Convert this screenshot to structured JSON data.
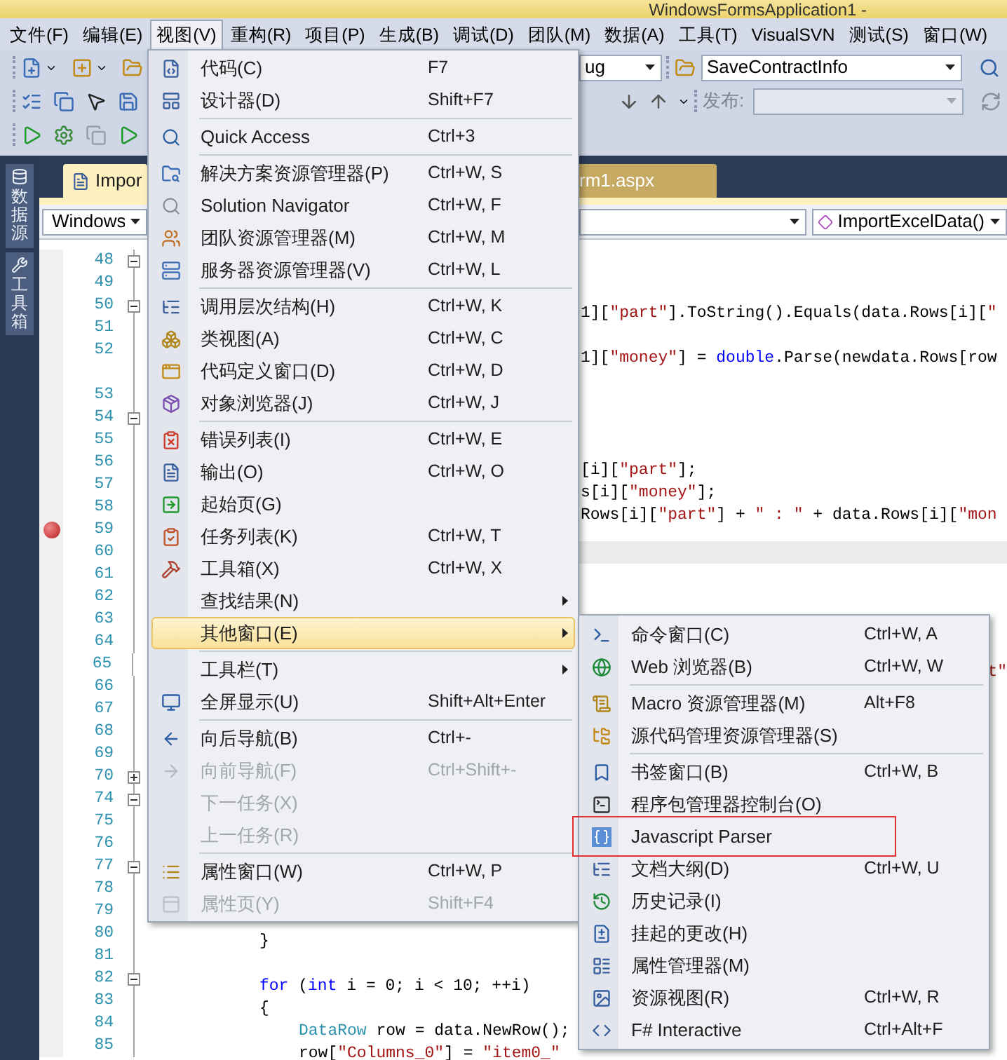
{
  "window": {
    "title": "WindowsFormsApplication1 -"
  },
  "menu_bar": [
    {
      "label": "文件(F)",
      "selected": false
    },
    {
      "label": "编辑(E)",
      "selected": false
    },
    {
      "label": "视图(V)",
      "selected": true
    },
    {
      "label": "重构(R)",
      "selected": false
    },
    {
      "label": "项目(P)",
      "selected": false
    },
    {
      "label": "生成(B)",
      "selected": false
    },
    {
      "label": "调试(D)",
      "selected": false
    },
    {
      "label": "团队(M)",
      "selected": false
    },
    {
      "label": "数据(A)",
      "selected": false
    },
    {
      "label": "工具(T)",
      "selected": false
    },
    {
      "label": "VisualSVN",
      "selected": false
    },
    {
      "label": "测试(S)",
      "selected": false
    },
    {
      "label": "窗口(W)",
      "selected": false
    }
  ],
  "toolbar": {
    "configuration_combo": "ug",
    "function_combo": "SaveContractInfo",
    "publish_label": "发布:",
    "publish_combo": {
      "disabled": true
    }
  },
  "side_tabs": [
    "数据源",
    "工具箱"
  ],
  "document_tabs": [
    {
      "label": "Impor",
      "selected": true
    },
    {
      "label": "rm1.aspx",
      "selected": false
    }
  ],
  "navigation": {
    "type_combo": "Windows",
    "member_combo": "ImportExcelData()"
  },
  "code_lines": [
    {
      "number": "48",
      "expanded": true,
      "breakpoint": false,
      "current": false
    },
    {
      "number": "49",
      "breakpoint": false,
      "current": false
    },
    {
      "number": "50",
      "expanded": true,
      "breakpoint": false,
      "current": false,
      "kind": "beside-menu",
      "segments": [
        {
          "text": "1][",
          "color": "#000000"
        },
        {
          "text": "\"part\"",
          "color": "#a31515"
        },
        {
          "text": "].ToString().Equals(data.Rows[i][",
          "color": "#000000"
        },
        {
          "text": "\"",
          "color": "#a31515"
        }
      ]
    },
    {
      "number": "51",
      "breakpoint": false,
      "current": false
    },
    {
      "number": "52",
      "breakpoint": false,
      "current": false,
      "kind": "beside-menu",
      "segments": [
        {
          "text": "1][",
          "color": "#000000"
        },
        {
          "text": "\"money\"",
          "color": "#a31515"
        },
        {
          "text": "] = ",
          "color": "#000000"
        },
        {
          "text": "double",
          "color": "#0000ff"
        },
        {
          "text": ".Parse(newdata.Rows[row",
          "color": "#000000"
        }
      ]
    },
    {
      "breakpoint": false,
      "current": false
    },
    {
      "number": "53",
      "breakpoint": false,
      "current": false
    },
    {
      "number": "54",
      "expanded": true,
      "breakpoint": false,
      "current": false
    },
    {
      "number": "55",
      "breakpoint": false,
      "current": false
    },
    {
      "number": "56",
      "breakpoint": false,
      "current": false,
      "kind": "beside-menu",
      "segments": [
        {
          "text": "[i][",
          "color": "#000000"
        },
        {
          "text": "\"part\"",
          "color": "#a31515"
        },
        {
          "text": "];",
          "color": "#000000"
        }
      ]
    },
    {
      "number": "57",
      "breakpoint": false,
      "current": false,
      "kind": "beside-menu",
      "segments": [
        {
          "text": "s[i][",
          "color": "#000000"
        },
        {
          "text": "\"money\"",
          "color": "#a31515"
        },
        {
          "text": "];",
          "color": "#000000"
        }
      ]
    },
    {
      "number": "58",
      "breakpoint": false,
      "current": false,
      "kind": "beside-menu",
      "segments": [
        {
          "text": "Rows[i][",
          "color": "#000000"
        },
        {
          "text": "\"part\"",
          "color": "#a31515"
        },
        {
          "text": "] + ",
          "color": "#000000"
        },
        {
          "text": "\" : \"",
          "color": "#a31515"
        },
        {
          "text": " + data.Rows[i][",
          "color": "#000000"
        },
        {
          "text": "\"mon",
          "color": "#a31515"
        }
      ]
    },
    {
      "number": "59",
      "breakpoint": true,
      "current": false
    },
    {
      "number": "60",
      "breakpoint": false,
      "current": true
    },
    {
      "number": "61",
      "breakpoint": false,
      "current": false
    },
    {
      "number": "62",
      "breakpoint": false,
      "current": false
    },
    {
      "number": "63",
      "breakpoint": false,
      "current": false
    },
    {
      "number": "64",
      "breakpoint": false,
      "current": false
    },
    {
      "number": "65",
      "breakpoint": false,
      "current": false,
      "kind": "far-right",
      "segments": [
        {
          "text": "t\"",
          "color": "#a31515"
        }
      ]
    },
    {
      "number": "66",
      "breakpoint": false,
      "current": false
    },
    {
      "number": "67",
      "breakpoint": false,
      "current": false
    },
    {
      "number": "68",
      "breakpoint": false,
      "current": false
    },
    {
      "number": "69",
      "breakpoint": false,
      "current": false
    },
    {
      "number": "70",
      "expanded": false,
      "breakpoint": false,
      "current": false
    },
    {
      "number": "74",
      "expanded": true,
      "breakpoint": false,
      "current": false
    },
    {
      "number": "75",
      "breakpoint": false,
      "current": false
    },
    {
      "number": "76",
      "breakpoint": false,
      "current": false
    },
    {
      "number": "77",
      "expanded": true,
      "breakpoint": false,
      "current": false
    },
    {
      "number": "78",
      "breakpoint": false,
      "current": false
    },
    {
      "number": "79",
      "breakpoint": false,
      "current": false
    },
    {
      "number": "80",
      "breakpoint": false,
      "current": false,
      "kind": "block",
      "segments": [
        {
          "text": "}",
          "color": "#000000"
        }
      ]
    },
    {
      "number": "81",
      "breakpoint": false,
      "current": false
    },
    {
      "number": "82",
      "expanded": true,
      "breakpoint": false,
      "current": false,
      "kind": "block",
      "segments": [
        {
          "text": "for",
          "color": "#0000ff"
        },
        {
          "text": " (",
          "color": "#000000"
        },
        {
          "text": "int",
          "color": "#0000ff"
        },
        {
          "text": " i = 0; i < 10; ++i)",
          "color": "#000000"
        }
      ]
    },
    {
      "number": "83",
      "breakpoint": false,
      "current": false,
      "kind": "block",
      "segments": [
        {
          "text": "{",
          "color": "#000000"
        }
      ]
    },
    {
      "number": "84",
      "breakpoint": false,
      "current": false,
      "kind": "nested",
      "segments": [
        {
          "text": "DataRow",
          "color": "#2b91af"
        },
        {
          "text": " row = data.NewRow();",
          "color": "#000000"
        }
      ]
    },
    {
      "number": "85",
      "breakpoint": false,
      "current": false,
      "kind": "nested",
      "segments": [
        {
          "text": "row[",
          "color": "#000000"
        },
        {
          "text": "\"Columns_0\"",
          "color": "#a31515"
        },
        {
          "text": "] = ",
          "color": "#000000"
        },
        {
          "text": "\"item0_\"",
          "color": "#a31515"
        }
      ]
    }
  ],
  "view_menu": {
    "items": [
      {
        "kind": "item",
        "label": "代码(C)",
        "shortcut": "F7",
        "disabled": false,
        "selected": false,
        "submenu": false
      },
      {
        "kind": "item",
        "label": "设计器(D)",
        "shortcut": "Shift+F7",
        "disabled": false,
        "selected": false,
        "submenu": false
      },
      {
        "kind": "separator"
      },
      {
        "kind": "item",
        "label": "Quick Access",
        "shortcut": "Ctrl+3",
        "disabled": false,
        "selected": false,
        "submenu": false
      },
      {
        "kind": "separator"
      },
      {
        "kind": "item",
        "label": "解决方案资源管理器(P)",
        "shortcut": "Ctrl+W, S",
        "disabled": false,
        "selected": false,
        "submenu": false
      },
      {
        "kind": "item",
        "label": "Solution Navigator",
        "shortcut": "Ctrl+W, F",
        "disabled": false,
        "selected": false,
        "submenu": false
      },
      {
        "kind": "item",
        "label": "团队资源管理器(M)",
        "shortcut": "Ctrl+W, M",
        "disabled": false,
        "selected": false,
        "submenu": false
      },
      {
        "kind": "item",
        "label": "服务器资源管理器(V)",
        "shortcut": "Ctrl+W, L",
        "disabled": false,
        "selected": false,
        "submenu": false
      },
      {
        "kind": "separator"
      },
      {
        "kind": "item",
        "label": "调用层次结构(H)",
        "shortcut": "Ctrl+W, K",
        "disabled": false,
        "selected": false,
        "submenu": false
      },
      {
        "kind": "item",
        "label": "类视图(A)",
        "shortcut": "Ctrl+W, C",
        "disabled": false,
        "selected": false,
        "submenu": false
      },
      {
        "kind": "item",
        "label": "代码定义窗口(D)",
        "shortcut": "Ctrl+W, D",
        "disabled": false,
        "selected": false,
        "submenu": false
      },
      {
        "kind": "item",
        "label": "对象浏览器(J)",
        "shortcut": "Ctrl+W, J",
        "disabled": false,
        "selected": false,
        "submenu": false
      },
      {
        "kind": "separator"
      },
      {
        "kind": "item",
        "label": "错误列表(I)",
        "shortcut": "Ctrl+W, E",
        "disabled": false,
        "selected": false,
        "submenu": false
      },
      {
        "kind": "item",
        "label": "输出(O)",
        "shortcut": "Ctrl+W, O",
        "disabled": false,
        "selected": false,
        "submenu": false
      },
      {
        "kind": "item",
        "label": "起始页(G)",
        "disabled": false,
        "selected": false,
        "submenu": false
      },
      {
        "kind": "item",
        "label": "任务列表(K)",
        "shortcut": "Ctrl+W, T",
        "disabled": false,
        "selected": false,
        "submenu": false
      },
      {
        "kind": "item",
        "label": "工具箱(X)",
        "shortcut": "Ctrl+W, X",
        "disabled": false,
        "selected": false,
        "submenu": false
      },
      {
        "kind": "item",
        "label": "查找结果(N)",
        "disabled": false,
        "selected": false,
        "submenu": true
      },
      {
        "kind": "item",
        "label": "其他窗口(E)",
        "disabled": false,
        "selected": true,
        "submenu": true
      },
      {
        "kind": "separator"
      },
      {
        "kind": "item",
        "label": "工具栏(T)",
        "disabled": false,
        "selected": false,
        "submenu": true
      },
      {
        "kind": "item",
        "label": "全屏显示(U)",
        "shortcut": "Shift+Alt+Enter",
        "disabled": false,
        "selected": false,
        "submenu": false
      },
      {
        "kind": "separator"
      },
      {
        "kind": "item",
        "label": "向后导航(B)",
        "shortcut": "Ctrl+-",
        "disabled": false,
        "selected": false,
        "submenu": false
      },
      {
        "kind": "item",
        "label": "向前导航(F)",
        "shortcut": "Ctrl+Shift+-",
        "disabled": true,
        "selected": false,
        "submenu": false
      },
      {
        "kind": "item",
        "label": "下一任务(X)",
        "disabled": true,
        "selected": false,
        "submenu": false
      },
      {
        "kind": "item",
        "label": "上一任务(R)",
        "disabled": true,
        "selected": false,
        "submenu": false
      },
      {
        "kind": "separator"
      },
      {
        "kind": "item",
        "label": "属性窗口(W)",
        "shortcut": "Ctrl+W, P",
        "disabled": false,
        "selected": false,
        "submenu": false
      },
      {
        "kind": "item",
        "label": "属性页(Y)",
        "shortcut": "Shift+F4",
        "disabled": true,
        "selected": false,
        "submenu": false
      }
    ]
  },
  "other_windows_menu": {
    "items": [
      {
        "kind": "item",
        "label": "命令窗口(C)",
        "shortcut": "Ctrl+W, A",
        "outlined": false
      },
      {
        "kind": "item",
        "label": "Web 浏览器(B)",
        "shortcut": "Ctrl+W, W",
        "outlined": false
      },
      {
        "kind": "separator"
      },
      {
        "kind": "item",
        "label": "Macro 资源管理器(M)",
        "shortcut": "Alt+F8",
        "outlined": false
      },
      {
        "kind": "item",
        "label": "源代码管理资源管理器(S)",
        "outlined": false
      },
      {
        "kind": "separator"
      },
      {
        "kind": "item",
        "label": "书签窗口(B)",
        "shortcut": "Ctrl+W, B",
        "outlined": false
      },
      {
        "kind": "item",
        "label": "程序包管理器控制台(O)",
        "outlined": false
      },
      {
        "kind": "item",
        "label": "Javascript Parser",
        "outlined": true
      },
      {
        "kind": "item",
        "label": "文档大纲(D)",
        "shortcut": "Ctrl+W, U",
        "outlined": false
      },
      {
        "kind": "item",
        "label": "历史记录(I)",
        "outlined": false
      },
      {
        "kind": "item",
        "label": "挂起的更改(H)",
        "outlined": false
      },
      {
        "kind": "item",
        "label": "属性管理器(M)",
        "outlined": false
      },
      {
        "kind": "item",
        "label": "资源视图(R)",
        "shortcut": "Ctrl+W, R",
        "outlined": false
      },
      {
        "kind": "item",
        "label": "F# Interactive",
        "shortcut": "Ctrl+Alt+F",
        "outlined": false
      }
    ]
  }
}
